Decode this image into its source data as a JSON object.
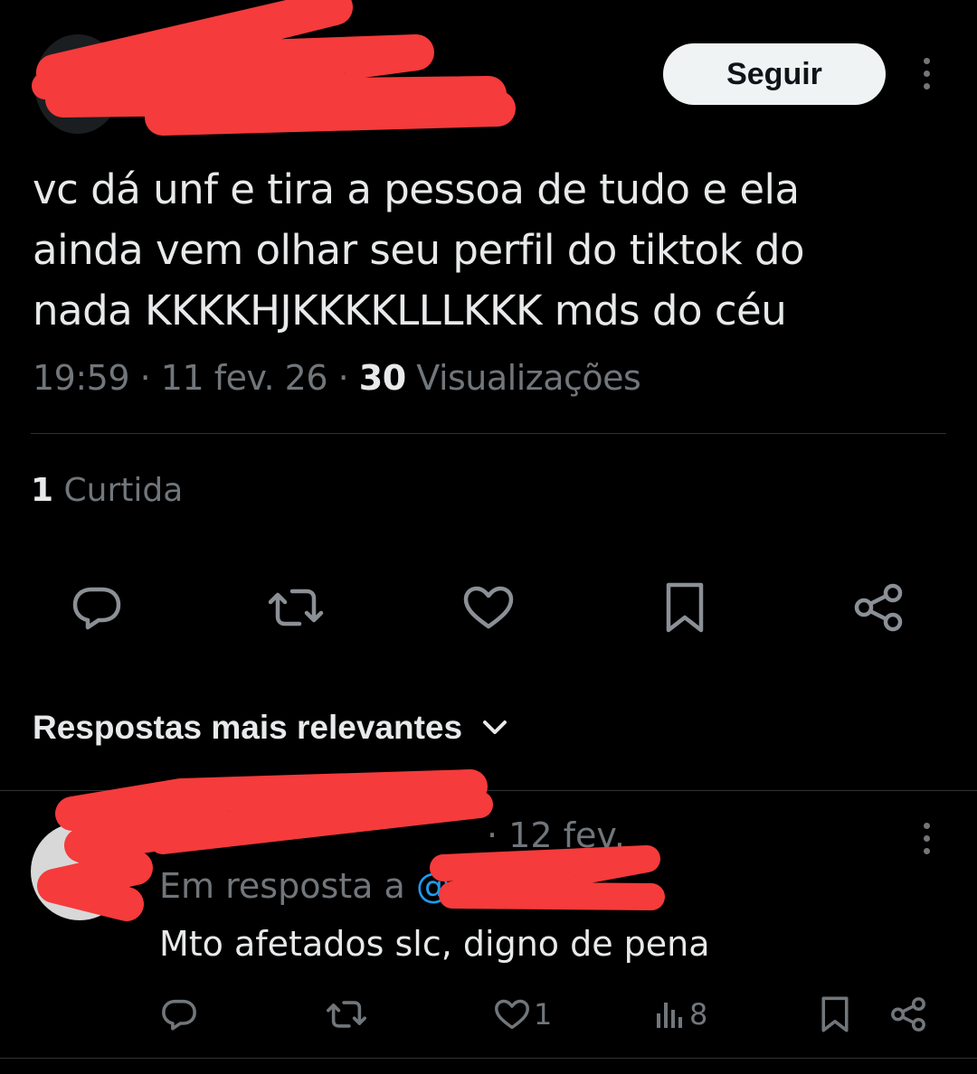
{
  "tweet": {
    "follow_label": "Seguir",
    "text": "vc dá unf e tira a pessoa de tudo e ela\nainda vem olhar seu perfil do tiktok do\nnada KKKKHJKKKKLLLKKK mds do céu",
    "time": "19:59",
    "date": "11 fev. 26",
    "views_count": "30",
    "views_label": "Visualizações",
    "likes_count": "1",
    "likes_label": "Curtida"
  },
  "replies_section": {
    "title": "Respostas mais relevantes"
  },
  "reply": {
    "date": "· 12 fev.",
    "in_reply_label": "Em resposta a",
    "mention": "@",
    "text": "Mto afetados slc, digno de pena",
    "likes": "1",
    "views": "8"
  },
  "icons": [
    "more-icon",
    "reply-icon",
    "retweet-icon",
    "like-icon",
    "bookmark-icon",
    "share-icon",
    "views-icon",
    "chevron-down-icon"
  ],
  "colors": {
    "background": "#000000",
    "text": "#e7e9ea",
    "muted": "#71767b",
    "link": "#1d9bf0",
    "redaction": "#f53b3b"
  }
}
